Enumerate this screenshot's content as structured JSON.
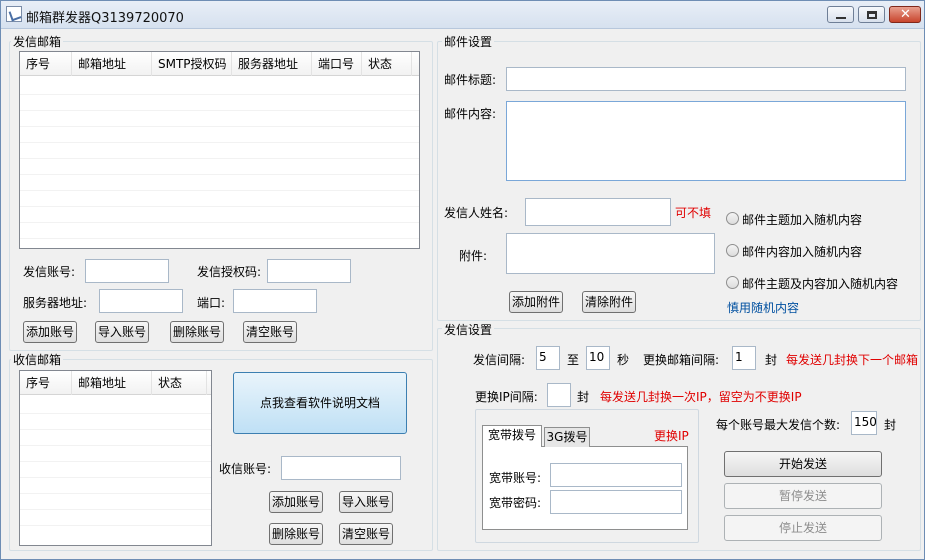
{
  "window": {
    "title": "邮箱群发器Q3139720070",
    "min": "—",
    "max": "□",
    "close": "✕"
  },
  "sender": {
    "group_title": "发信邮箱",
    "columns": [
      "序号",
      "邮箱地址",
      "SMTP授权码",
      "服务器地址",
      "端口号",
      "状态"
    ],
    "account_label": "发信账号:",
    "auth_label": "发信授权码:",
    "server_label": "服务器地址:",
    "port_label": "端口:",
    "account_value": "",
    "auth_value": "",
    "server_value": "",
    "port_value": "",
    "buttons": {
      "add": "添加账号",
      "import": "导入账号",
      "delete": "删除账号",
      "clear": "清空账号"
    }
  },
  "receiver": {
    "group_title": "收信邮箱",
    "columns": [
      "序号",
      "邮箱地址",
      "状态"
    ],
    "doc_button": "点我查看软件说明文档",
    "account_label": "收信账号:",
    "account_value": "",
    "buttons": {
      "add": "添加账号",
      "import": "导入账号",
      "delete": "删除账号",
      "clear": "清空账号"
    }
  },
  "mail": {
    "group_title": "邮件设置",
    "subject_label": "邮件标题:",
    "subject_value": "",
    "content_label": "邮件内容:",
    "sender_name_label": "发信人姓名:",
    "sender_name_value": "",
    "optional_note": "可不填",
    "attachment_label": "附件:",
    "add_attachment": "添加附件",
    "clear_attachment": "清除附件",
    "radio_subject_random": "邮件主题加入随机内容",
    "radio_content_random": "邮件内容加入随机内容",
    "radio_both_random": "邮件主题及内容加入随机内容",
    "random_warning": "慎用随机内容"
  },
  "send": {
    "group_title": "发信设置",
    "interval_label": "发信间隔:",
    "interval_min": "5",
    "interval_to": "至",
    "interval_max": "10",
    "interval_unit": "秒",
    "switch_mailbox_label": "更换邮箱间隔:",
    "switch_mailbox_value": "1",
    "switch_mailbox_unit": "封",
    "switch_mailbox_hint": "每发送几封换下一个邮箱",
    "switch_ip_label": "更换IP间隔:",
    "switch_ip_value": "",
    "switch_ip_unit": "封",
    "switch_ip_hint": "每发送几封换一次IP，留空为不更换IP",
    "max_per_account_label": "每个账号最大发信个数:",
    "max_per_account_value": "150",
    "max_per_account_unit": "封",
    "tabs": [
      "宽带拨号",
      "3G拨号"
    ],
    "change_ip": "更换IP",
    "broadband_account_label": "宽带账号:",
    "broadband_password_label": "宽带密码:",
    "broadband_account_value": "",
    "broadband_password_value": "",
    "start": "开始发送",
    "pause": "暂停发送",
    "stop": "停止发送"
  }
}
